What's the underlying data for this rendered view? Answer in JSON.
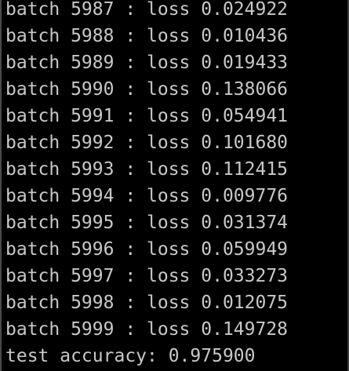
{
  "console": {
    "lines": [
      "batch 5987 : loss 0.024922",
      "batch 5988 : loss 0.010436",
      "batch 5989 : loss 0.019433",
      "batch 5990 : loss 0.138066",
      "batch 5991 : loss 0.054941",
      "batch 5992 : loss 0.101680",
      "batch 5993 : loss 0.112415",
      "batch 5994 : loss 0.009776",
      "batch 5995 : loss 0.031374",
      "batch 5996 : loss 0.059949",
      "batch 5997 : loss 0.033273",
      "batch 5998 : loss 0.012075",
      "batch 5999 : loss 0.149728",
      "test accuracy: 0.975900"
    ],
    "text_color": "#c8c8c8",
    "background_color": "#000000"
  }
}
